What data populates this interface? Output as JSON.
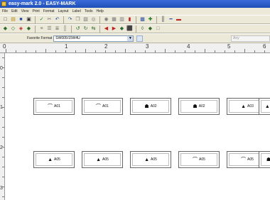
{
  "window": {
    "title": "easy-mark 2.0 - EASY-MARK"
  },
  "menu": [
    "File",
    "Edit",
    "View",
    "Print",
    "Format",
    "Layout",
    "Label",
    "Tools",
    "Help"
  ],
  "toolbar1": [
    {
      "name": "new-icon",
      "glyph": "□"
    },
    {
      "name": "open-icon",
      "glyph": "▤"
    },
    {
      "name": "save-icon",
      "glyph": "■"
    },
    {
      "name": "print-icon",
      "glyph": "▣"
    },
    {
      "name": "spellcheck-icon",
      "glyph": "✓"
    },
    {
      "name": "cut-icon",
      "glyph": "✂"
    },
    {
      "name": "undo-icon",
      "glyph": "↶"
    },
    {
      "name": "redo-icon",
      "glyph": "↷"
    },
    {
      "name": "copy-icon",
      "glyph": "❐"
    },
    {
      "name": "paste-icon",
      "glyph": "▧"
    },
    {
      "name": "find-icon",
      "glyph": "◎"
    },
    {
      "name": "zoom-icon",
      "glyph": "◉"
    },
    {
      "name": "grid-icon",
      "glyph": "▦"
    },
    {
      "name": "table-icon",
      "glyph": "▥"
    },
    {
      "name": "chart-icon",
      "glyph": "▮"
    },
    {
      "name": "image-icon",
      "glyph": "▩"
    },
    {
      "name": "insert-icon",
      "glyph": "✚"
    },
    {
      "name": "barcode-icon",
      "glyph": "║"
    },
    {
      "name": "line-icon",
      "glyph": "━"
    },
    {
      "name": "delete-icon",
      "glyph": "▬"
    }
  ],
  "toolbar2": [
    {
      "name": "arrow-left-icon",
      "glyph": "◆"
    },
    {
      "name": "arrow-up-icon",
      "glyph": "◇"
    },
    {
      "name": "arrow-down-icon",
      "glyph": "◈"
    },
    {
      "name": "arrow-right-icon",
      "glyph": "◆"
    },
    {
      "name": "align-left-icon",
      "glyph": "≡"
    },
    {
      "name": "align-center-icon",
      "glyph": "☰"
    },
    {
      "name": "align-right-icon",
      "glyph": "≣"
    },
    {
      "name": "distribute-icon",
      "glyph": "║"
    },
    {
      "name": "rotate-left-icon",
      "glyph": "↺"
    },
    {
      "name": "rotate-right-icon",
      "glyph": "↻"
    },
    {
      "name": "mirror-icon",
      "glyph": "⇆"
    },
    {
      "name": "move-back-icon",
      "glyph": "◀"
    },
    {
      "name": "move-forward-icon",
      "glyph": "▶"
    },
    {
      "name": "layer-icon",
      "glyph": "◆"
    },
    {
      "name": "group-icon",
      "glyph": "⬛"
    },
    {
      "name": "ungroup-icon",
      "glyph": "◊"
    },
    {
      "name": "fill-icon",
      "glyph": "◆"
    },
    {
      "name": "frame-icon",
      "glyph": "□"
    }
  ],
  "fontbar": {
    "label": "Favorite Format",
    "value": "SW005/15W4U",
    "right_placeholder": "Any"
  },
  "ruler": {
    "h": [
      "0",
      "1",
      "2",
      "3",
      "4",
      "5",
      "6"
    ],
    "v": [
      "0",
      "1",
      "2",
      "3"
    ]
  },
  "labels_row1": [
    {
      "text": "A01",
      "icon": "⌒"
    },
    {
      "text": "A01",
      "icon": "⌒"
    },
    {
      "text": "A02",
      "icon": "☗"
    },
    {
      "text": "A02",
      "icon": "☗"
    },
    {
      "text": "A03",
      "icon": "▲"
    },
    {
      "text": "A",
      "icon": "▲"
    }
  ],
  "labels_row2": [
    {
      "text": "A05",
      "icon": "▲"
    },
    {
      "text": "A05",
      "icon": "▲"
    },
    {
      "text": "A05",
      "icon": "▲"
    },
    {
      "text": "A05",
      "icon": "⌒"
    },
    {
      "text": "A05",
      "icon": "⌒"
    },
    {
      "text": "",
      "icon": "☗"
    }
  ],
  "colors": {
    "titlebar": "#1f4fb8",
    "chrome": "#ece9d8"
  }
}
